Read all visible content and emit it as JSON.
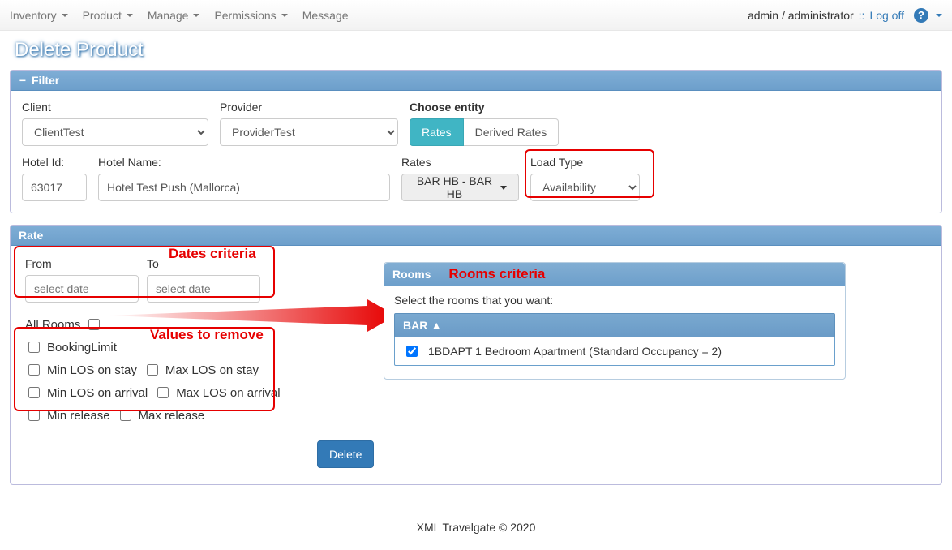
{
  "nav": {
    "items": [
      "Inventory",
      "Product",
      "Manage",
      "Permissions",
      "Message"
    ],
    "user": "admin / administrator",
    "sep": "::",
    "logoff": "Log off"
  },
  "page_title": "Delete Product",
  "filter": {
    "header": "Filter",
    "client_label": "Client",
    "client_value": "ClientTest",
    "provider_label": "Provider",
    "provider_value": "ProviderTest",
    "choose_entity_label": "Choose entity",
    "entity_rates": "Rates",
    "entity_derived": "Derived Rates",
    "hotel_id_label": "Hotel Id:",
    "hotel_id_value": "63017",
    "hotel_name_label": "Hotel Name:",
    "hotel_name_value": "Hotel Test Push (Mallorca)",
    "rates_label": "Rates",
    "rates_value": "BAR HB - BAR HB",
    "load_type_label": "Load Type",
    "load_type_value": "Availability"
  },
  "rate": {
    "header": "Rate",
    "from_label": "From",
    "to_label": "To",
    "date_placeholder": "select date",
    "all_rooms_label": "All Rooms",
    "values": {
      "booking_limit": "BookingLimit",
      "min_los_stay": "Min LOS on stay",
      "max_los_stay": "Max LOS on stay",
      "min_los_arrival": "Min LOS on arrival",
      "max_los_arrival": "Max LOS on arrival",
      "min_release": "Min release",
      "max_release": "Max release"
    },
    "rooms": {
      "header": "Rooms",
      "instruction": "Select the rooms that you want:",
      "group": "BAR ▲",
      "room_label": "1BDAPT 1 Bedroom Apartment (Standard Occupancy = 2)"
    }
  },
  "annotations": {
    "dates": "Dates criteria",
    "values": "Values to remove",
    "rooms": "Rooms criteria"
  },
  "delete_button": "Delete",
  "footer": "XML Travelgate © 2020"
}
